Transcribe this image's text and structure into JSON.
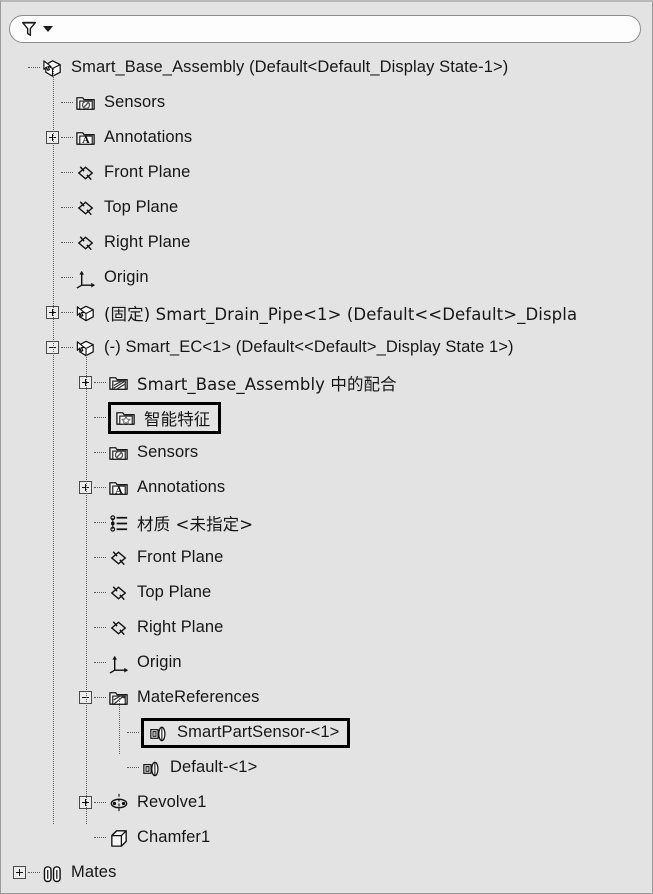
{
  "app": {
    "name": "SolidWorks FeatureManager Design Tree"
  },
  "filter_bar": {
    "icon": "funnel-filter-icon",
    "caret": "chevron-down-icon",
    "value": "",
    "placeholder": ""
  },
  "colors": {
    "panel_background": "#e3e3e3",
    "filter_background": "#fdfdfd",
    "text": "#161616",
    "tree_line": "#5a5a5a",
    "highlight_border": "#000000"
  },
  "tree": {
    "rows": [
      {
        "label": "Smart_Base_Assembly  (Default<Default_Display State-1>)",
        "icon": "assembly-icon",
        "depth": 0,
        "toggle": "none",
        "highlighted": false,
        "cjk": false
      },
      {
        "label": "Sensors",
        "icon": "sensors-folder-icon",
        "depth": 1,
        "toggle": "none",
        "highlighted": false,
        "cjk": false
      },
      {
        "label": "Annotations",
        "icon": "annotations-folder-icon",
        "depth": 1,
        "toggle": "plus",
        "highlighted": false,
        "cjk": false
      },
      {
        "label": "Front Plane",
        "icon": "plane-icon",
        "depth": 1,
        "toggle": "none",
        "highlighted": false,
        "cjk": false
      },
      {
        "label": "Top Plane",
        "icon": "plane-icon",
        "depth": 1,
        "toggle": "none",
        "highlighted": false,
        "cjk": false
      },
      {
        "label": "Right Plane",
        "icon": "plane-icon",
        "depth": 1,
        "toggle": "none",
        "highlighted": false,
        "cjk": false
      },
      {
        "label": "Origin",
        "icon": "origin-icon",
        "depth": 1,
        "toggle": "none",
        "highlighted": false,
        "cjk": false
      },
      {
        "label": "(固定) Smart_Drain_Pipe<1> (Default<<Default>_Displa",
        "icon": "component-icon",
        "depth": 1,
        "toggle": "plus",
        "highlighted": false,
        "cjk": true
      },
      {
        "label": "(-) Smart_EC<1> (Default<<Default>_Display State 1>)",
        "icon": "component-icon",
        "depth": 1,
        "toggle": "minus",
        "highlighted": false,
        "cjk": false
      },
      {
        "label": "Smart_Base_Assembly 中的配合",
        "icon": "mates-folder-icon",
        "depth": 2,
        "toggle": "plus",
        "highlighted": false,
        "cjk": true
      },
      {
        "label": "智能特征",
        "icon": "smart-feature-folder-icon",
        "depth": 2,
        "toggle": "none",
        "highlighted": true,
        "cjk": true
      },
      {
        "label": "Sensors",
        "icon": "sensors-folder-icon",
        "depth": 2,
        "toggle": "none",
        "highlighted": false,
        "cjk": false
      },
      {
        "label": "Annotations",
        "icon": "annotations-folder-icon",
        "depth": 2,
        "toggle": "plus",
        "highlighted": false,
        "cjk": false
      },
      {
        "label": "材质 <未指定>",
        "icon": "material-icon",
        "depth": 2,
        "toggle": "none",
        "highlighted": false,
        "cjk": true
      },
      {
        "label": "Front Plane",
        "icon": "plane-icon",
        "depth": 2,
        "toggle": "none",
        "highlighted": false,
        "cjk": false
      },
      {
        "label": "Top Plane",
        "icon": "plane-icon",
        "depth": 2,
        "toggle": "none",
        "highlighted": false,
        "cjk": false
      },
      {
        "label": "Right Plane",
        "icon": "plane-icon",
        "depth": 2,
        "toggle": "none",
        "highlighted": false,
        "cjk": false
      },
      {
        "label": "Origin",
        "icon": "origin-icon",
        "depth": 2,
        "toggle": "none",
        "highlighted": false,
        "cjk": false
      },
      {
        "label": "MateReferences",
        "icon": "mate-references-icon",
        "depth": 2,
        "toggle": "minus",
        "highlighted": false,
        "cjk": false
      },
      {
        "label": "SmartPartSensor-<1>",
        "icon": "mate-reference-item-icon",
        "depth": 3,
        "toggle": "none",
        "highlighted": true,
        "cjk": false
      },
      {
        "label": "Default-<1>",
        "icon": "mate-reference-item-icon",
        "depth": 3,
        "toggle": "none",
        "highlighted": false,
        "cjk": false
      },
      {
        "label": "Revolve1",
        "icon": "revolve-icon",
        "depth": 2,
        "toggle": "plus",
        "highlighted": false,
        "cjk": false
      },
      {
        "label": "Chamfer1",
        "icon": "chamfer-icon",
        "depth": 2,
        "toggle": "none",
        "highlighted": false,
        "cjk": false
      },
      {
        "label": "Mates",
        "icon": "mates-paperclip-icon",
        "depth": 0,
        "toggle": "plus",
        "highlighted": false,
        "cjk": false
      }
    ]
  }
}
